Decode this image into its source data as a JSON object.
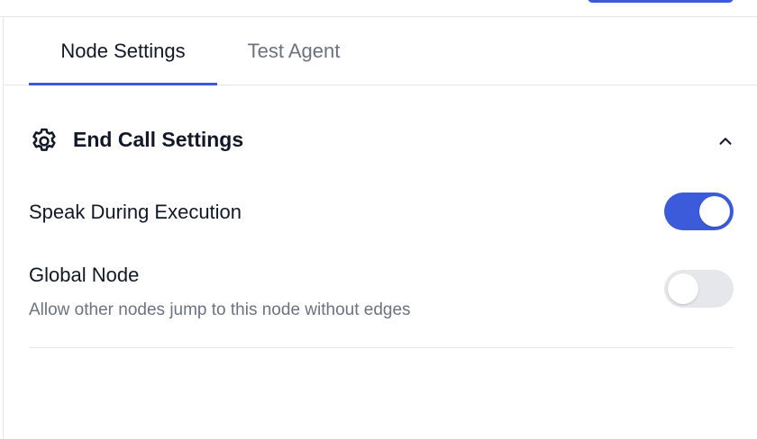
{
  "tabs": [
    {
      "label": "Node Settings",
      "active": true
    },
    {
      "label": "Test Agent",
      "active": false
    }
  ],
  "section": {
    "title": "End Call Settings",
    "icon": "gear-icon",
    "collapse_icon": "chevron-up-icon"
  },
  "settings": {
    "speak": {
      "label": "Speak During Execution",
      "enabled": true
    },
    "global": {
      "label": "Global Node",
      "description": "Allow other nodes jump to this node without edges",
      "enabled": false
    }
  },
  "colors": {
    "accent": "#3b5bdb",
    "muted_text": "#6b7280",
    "border": "#e5e7eb"
  }
}
